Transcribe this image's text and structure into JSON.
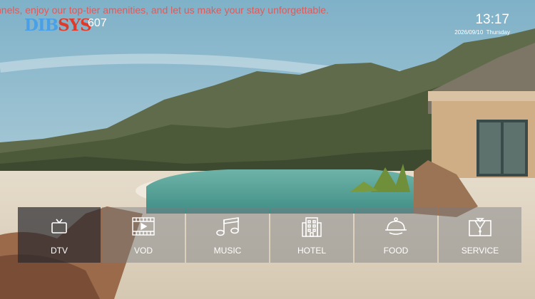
{
  "ticker": {
    "text": "nnels, enjoy our top-tier amenities, and let us make your stay unforgettable."
  },
  "brand": {
    "logo_part1": "DIB",
    "logo_part2": "SYS"
  },
  "room": {
    "number": "607"
  },
  "clock": {
    "time": "13:17",
    "date": "2026/09/10",
    "weekday": "Thursday"
  },
  "menu": {
    "items": [
      {
        "label": "DTV",
        "icon": "tv-icon"
      },
      {
        "label": "VOD",
        "icon": "film-icon"
      },
      {
        "label": "MUSIC",
        "icon": "music-note-icon"
      },
      {
        "label": "HOTEL",
        "icon": "building-icon"
      },
      {
        "label": "FOOD",
        "icon": "cloche-icon"
      },
      {
        "label": "SERVICE",
        "icon": "bellhop-icon"
      }
    ],
    "active_index": 0
  },
  "colors": {
    "ticker": "#e05a5a",
    "logo_blue": "#4aa0e6",
    "logo_red": "#e23a2a"
  }
}
